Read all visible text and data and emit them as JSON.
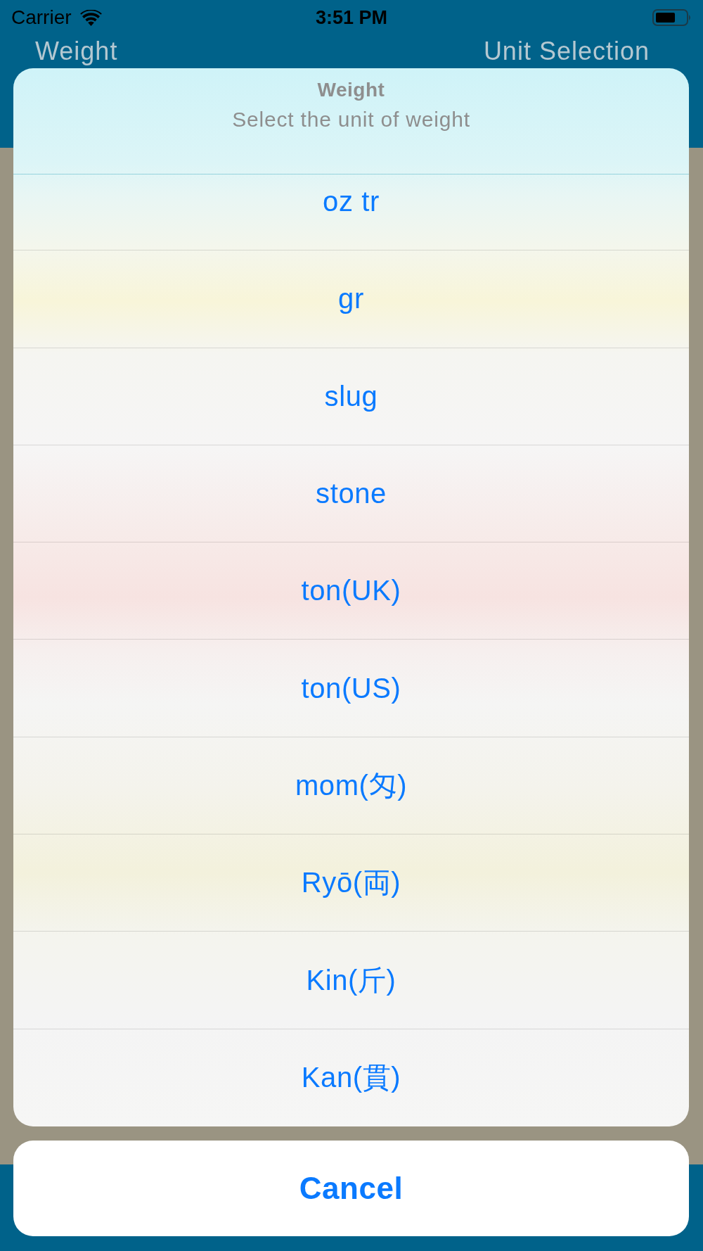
{
  "status_bar": {
    "carrier": "Carrier",
    "time": "3:51 PM"
  },
  "nav_bar": {
    "left_title": "Weight",
    "right_title": "Unit Selection"
  },
  "action_sheet": {
    "title": "Weight",
    "message": "Select the unit of weight",
    "options": [
      "oz tr",
      "gr",
      "slug",
      "stone",
      "ton(UK)",
      "ton(US)",
      "mom(匁)",
      "Ryō(両)",
      "Kin(斤)",
      "Kan(貫)"
    ],
    "cancel": "Cancel"
  }
}
